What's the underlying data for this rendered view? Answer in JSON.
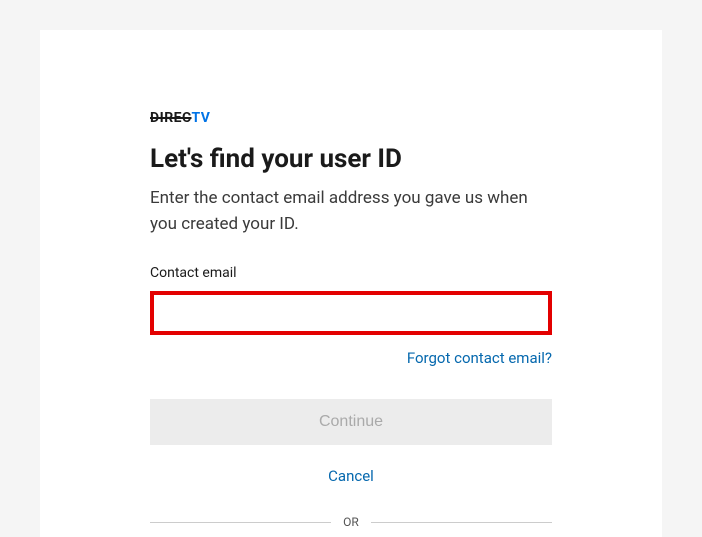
{
  "logo": {
    "part1": "DIREC",
    "part2": "TV"
  },
  "heading": "Let's find your user ID",
  "subheading": "Enter the contact email address you gave us when you created your ID.",
  "form": {
    "email_label": "Contact email",
    "email_value": "",
    "forgot_link": "Forgot contact email?",
    "continue_label": "Continue",
    "cancel_label": "Cancel"
  },
  "divider": {
    "text": "OR"
  }
}
